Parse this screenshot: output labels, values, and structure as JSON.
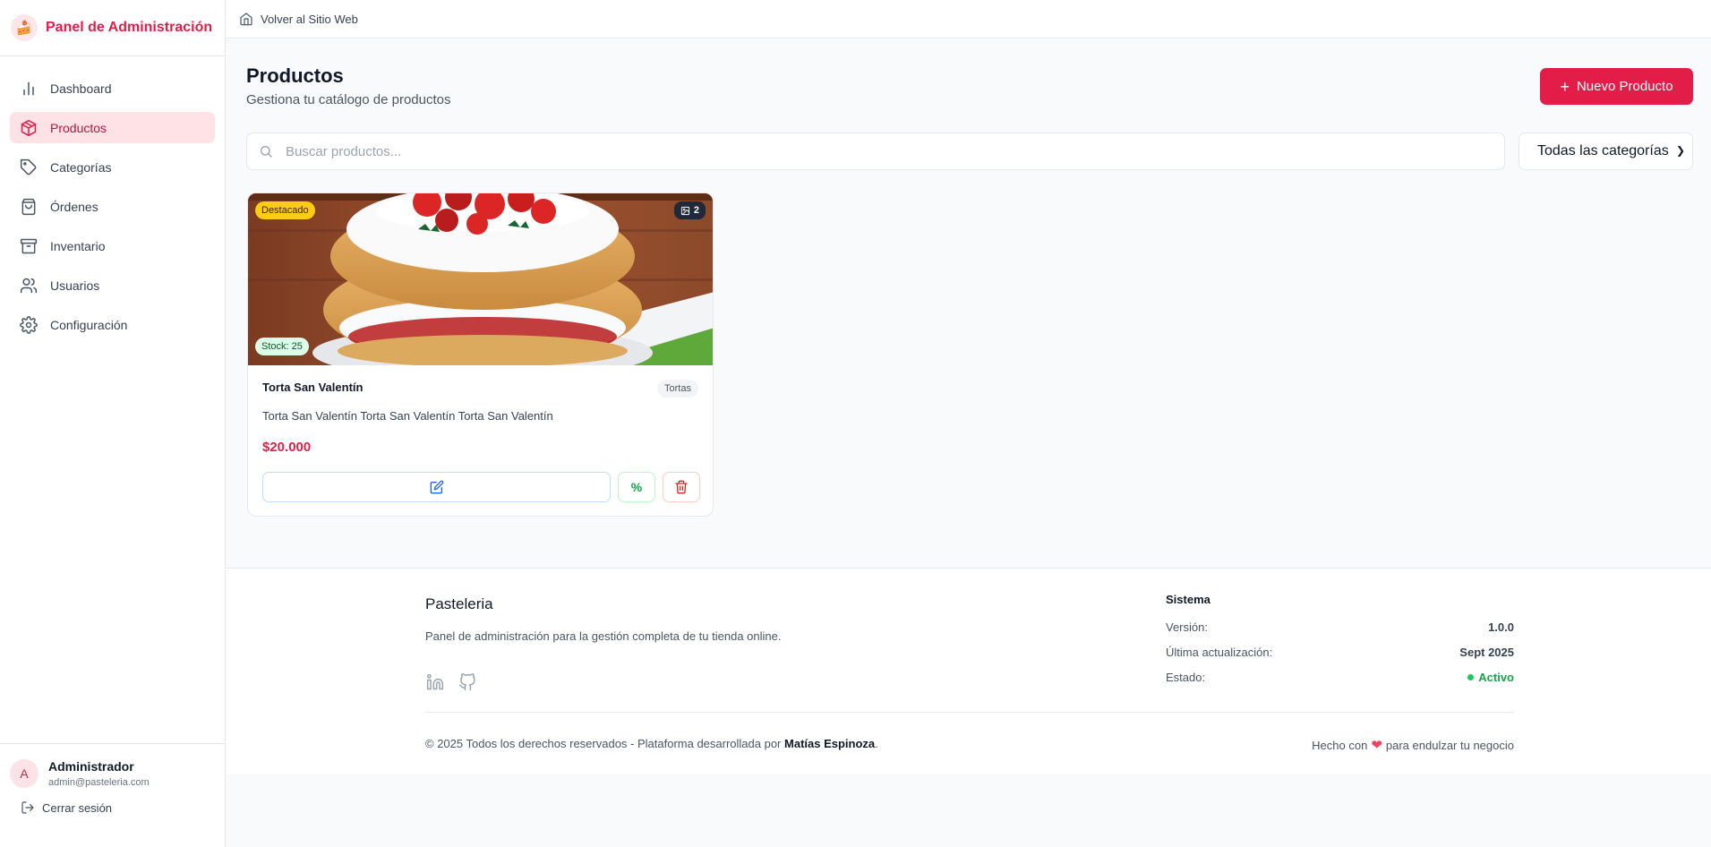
{
  "sidebar": {
    "brand_icon": "🍰",
    "brand_title": "Panel de Administración",
    "items": [
      {
        "label": "Dashboard",
        "icon": "bar-chart-icon"
      },
      {
        "label": "Productos",
        "icon": "package-icon",
        "active": true
      },
      {
        "label": "Categorías",
        "icon": "tag-icon"
      },
      {
        "label": "Órdenes",
        "icon": "shopping-bag-icon"
      },
      {
        "label": "Inventario",
        "icon": "archive-icon"
      },
      {
        "label": "Usuarios",
        "icon": "users-icon"
      },
      {
        "label": "Configuración",
        "icon": "gear-icon"
      }
    ],
    "user": {
      "initial": "A",
      "name": "Administrador",
      "email": "admin@pasteleria.com"
    },
    "logout_label": "Cerrar sesión"
  },
  "topbar": {
    "back_label": "Volver al Sitio Web"
  },
  "header": {
    "title": "Productos",
    "subtitle": "Gestiona tu catálogo de productos",
    "new_button": "Nuevo Producto",
    "new_button_icon": "+"
  },
  "filters": {
    "search_placeholder": "Buscar productos...",
    "category_selected": "Todas las categorías"
  },
  "products": [
    {
      "badge_featured": "Destacado",
      "image_count": "2",
      "stock_label": "Stock: 25",
      "name": "Torta San Valentín",
      "category": "Tortas",
      "description": "Torta San Valentín Torta San Valentín Torta San Valentín",
      "price": "$20.000",
      "discount_label": "%"
    }
  ],
  "footer": {
    "brand": "Pasteleria",
    "description": "Panel de administración para la gestión completa de tu tienda online.",
    "system_title": "Sistema",
    "system_rows": [
      {
        "key": "Versión:",
        "value": "1.0.0"
      },
      {
        "key": "Última actualización:",
        "value": "Sept 2025"
      },
      {
        "key": "Estado:",
        "value": "Activo"
      }
    ],
    "copyright_prefix": "© 2025 Todos los derechos reservados - Plataforma desarrollada por",
    "author": "Matías Espinoza",
    "copyright_suffix": ".",
    "made_prefix": "Hecho con",
    "made_suffix": "para endulzar tu negocio"
  },
  "colors": {
    "brand": "#e11d48",
    "featured": "#facc15",
    "stock": "#dcfce7",
    "active_status": "#16a34a"
  }
}
